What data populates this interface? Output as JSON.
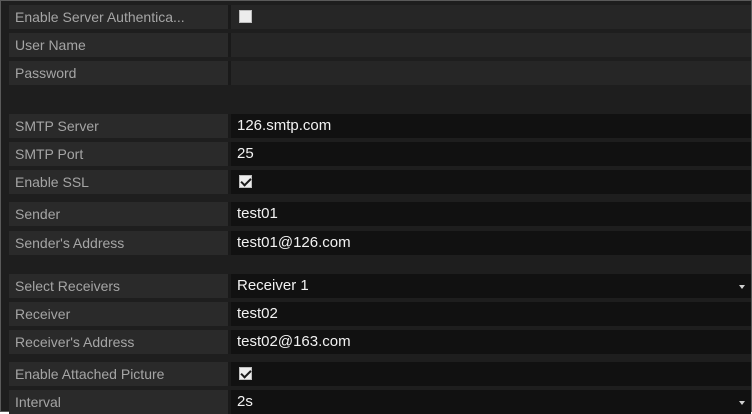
{
  "form": {
    "rows": [
      {
        "label": "Enable Server Authentica...",
        "type": "checkbox",
        "checked": false
      },
      {
        "label": "User Name",
        "type": "text",
        "value": ""
      },
      {
        "label": "Password",
        "type": "password",
        "value": ""
      },
      {
        "label": "SMTP Server",
        "type": "text",
        "value": "126.smtp.com"
      },
      {
        "label": "SMTP Port",
        "type": "text",
        "value": "25"
      },
      {
        "label": "Enable SSL",
        "type": "checkbox",
        "checked": true
      },
      {
        "label": "Sender",
        "type": "text",
        "value": "test01"
      },
      {
        "label": "Sender's Address",
        "type": "text",
        "value": "test01@126.com"
      },
      {
        "label": "Select Receivers",
        "type": "select",
        "value": "Receiver 1"
      },
      {
        "label": "Receiver",
        "type": "text",
        "value": "test02"
      },
      {
        "label": "Receiver's Address",
        "type": "text",
        "value": "test02@163.com"
      },
      {
        "label": "Enable Attached Picture",
        "type": "checkbox",
        "checked": true
      },
      {
        "label": "Interval",
        "type": "select",
        "value": "2s"
      }
    ]
  }
}
